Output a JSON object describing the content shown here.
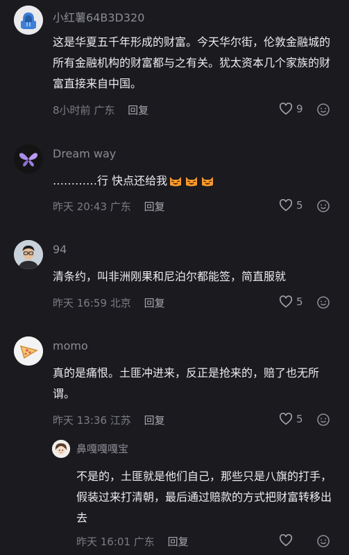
{
  "comments": [
    {
      "username": "小红薯64B3D320",
      "text": "这是华夏五千年形成的财富。今天华尔街，伦敦金融城的所有金融机构的财富都与之有关。犹太资本几个家族的财富直接来自中国。",
      "time": "8小时前",
      "location": "广东",
      "reply_label": "回复",
      "likes": "9",
      "avatar_icon": "blue-hoodie-avatar"
    },
    {
      "username": "Dream way",
      "text": "…………行 快点还给我",
      "emoji": [
        "cat-laugh-emoji",
        "cat-laugh-emoji",
        "cat-laugh-emoji"
      ],
      "time": "昨天 20:43",
      "location": "广东",
      "reply_label": "回复",
      "likes": "5",
      "avatar_icon": "purple-butterfly-avatar"
    },
    {
      "username": "94",
      "text": "清条约，叫非洲刚果和尼泊尔都能签，简直服就",
      "time": "昨天 16:59",
      "location": "北京",
      "reply_label": "回复",
      "likes": "5",
      "avatar_icon": "man-with-glasses-avatar"
    },
    {
      "username": "momo",
      "text": "真的是痛恨。土匪冲进来，反正是抢来的，赔了也无所谓。",
      "time": "昨天 13:36",
      "location": "江苏",
      "reply_label": "回复",
      "likes": "5",
      "avatar_icon": "pizza-avatar"
    }
  ],
  "reply": {
    "username": "鼻嘎嘎嘎宝",
    "text": "不是的，土匪就是他们自己，那些只是八旗的打手，假装过来打清朝，最后通过赔款的方式把财富转移出去",
    "time": "昨天 16:01",
    "location": "广东",
    "reply_label": "回复",
    "avatar_icon": "cartoon-girl-avatar"
  }
}
